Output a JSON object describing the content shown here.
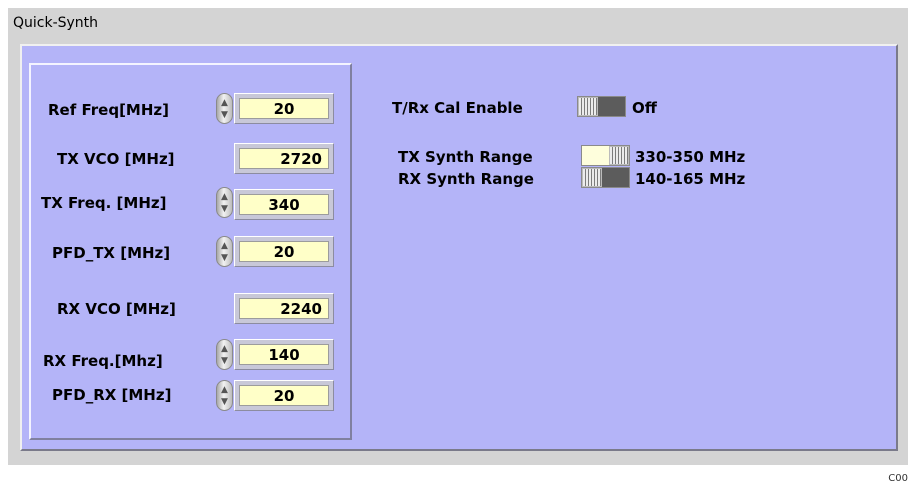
{
  "panel": {
    "title": "Quick-Synth"
  },
  "left": {
    "ref_freq": {
      "label": "Ref Freq[MHz]",
      "value": "20"
    },
    "tx_vco": {
      "label": "TX VCO [MHz]",
      "value": "2720"
    },
    "tx_freq": {
      "label": "TX Freq. [MHz]",
      "value": "340"
    },
    "pfd_tx": {
      "label": "PFD_TX [MHz]",
      "value": "20"
    },
    "rx_vco": {
      "label": "RX VCO [MHz]",
      "value": "2240"
    },
    "rx_freq": {
      "label": "RX Freq.[Mhz]",
      "value": "140"
    },
    "pfd_rx": {
      "label": "PFD_RX [MHz]",
      "value": "20"
    }
  },
  "right": {
    "cal_enable": {
      "label": "T/Rx  Cal Enable",
      "state": "Off",
      "is_on": false
    },
    "tx_synth_range": {
      "label": "TX Synth Range",
      "value": "330-350 MHz",
      "is_on": true
    },
    "rx_synth_range": {
      "label": "RX Synth Range",
      "value": "140-165 MHz",
      "is_on": false
    }
  },
  "icons": {
    "spinner": "up-down-arrows-icon"
  },
  "colors": {
    "panel_bg": "#b4b4f8",
    "field_bg": "#ffffc8",
    "frame_bg": "#d4d4d4"
  },
  "footer": {
    "code": "C00"
  }
}
